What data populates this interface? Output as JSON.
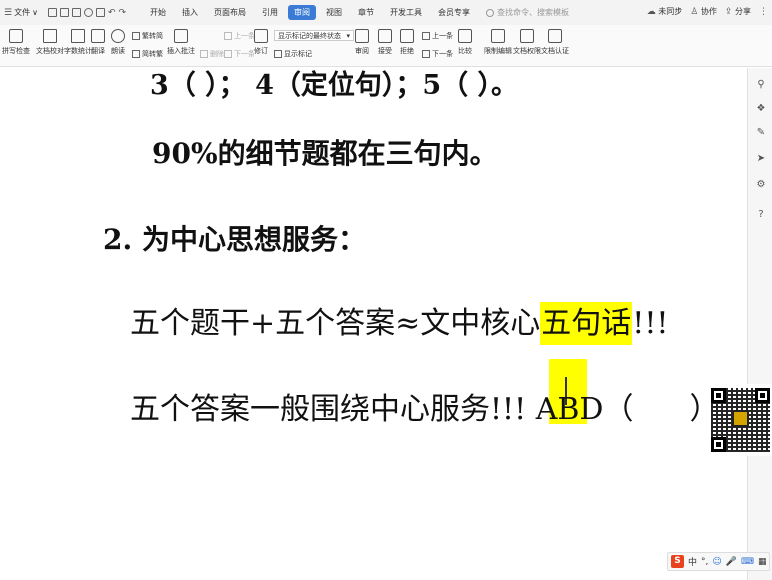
{
  "menubar": {
    "file_label": "文件",
    "file_chevron": "∨",
    "tabs": [
      {
        "label": "开始"
      },
      {
        "label": "插入"
      },
      {
        "label": "页面布局"
      },
      {
        "label": "引用"
      },
      {
        "label": "审阅",
        "active": true
      },
      {
        "label": "视图"
      },
      {
        "label": "章节"
      },
      {
        "label": "开发工具"
      },
      {
        "label": "会员专享"
      }
    ],
    "search_placeholder": "查找命令、搜索模板",
    "sync_label": "未同步",
    "collab_label": "协作",
    "share_label": "分享"
  },
  "ribbon": {
    "spellcheck": "拼写检查",
    "doc_proof": "文档校对",
    "word_count": "字数统计",
    "translate": "翻译",
    "read_aloud": "朗读",
    "simp_to_trad": "繁转简",
    "trad_to_simp": "简转繁",
    "insert_comment": "插入批注",
    "delete": "删除",
    "prev": "上一条",
    "next": "下一条",
    "track_changes": "修订",
    "markup_state": "显示标记的最终状态",
    "show_markup": "显示标记",
    "review": "审阅",
    "accept": "接受",
    "reject": "拒绝",
    "prev2": "上一条",
    "next2": "下一条",
    "compare": "比较",
    "restrict_edit": "限制编辑",
    "doc_permission": "文档权限",
    "doc_certify": "文档认证"
  },
  "document": {
    "line1": "3（  ）； 4（定位句）；5（  ）。",
    "line2": "90%的细节题都在三句内。",
    "line3": "2. 为中心思想服务：",
    "line4_pre": "五个题干+五个答案≈文中核心",
    "line4_hl": "五句话",
    "line4_post": "!!!",
    "line5_pre": "五个答案一般围绕中心服务!!! ABD（",
    "line5_post": "）D"
  },
  "ime": {
    "logo": "S",
    "lang": "中",
    "punct": "°,",
    "emoji": "☺",
    "mic": "🎤"
  },
  "colors": {
    "highlight": "#ffff00",
    "active_tab": "#3a7bd5",
    "ime_logo": "#e8431f"
  }
}
